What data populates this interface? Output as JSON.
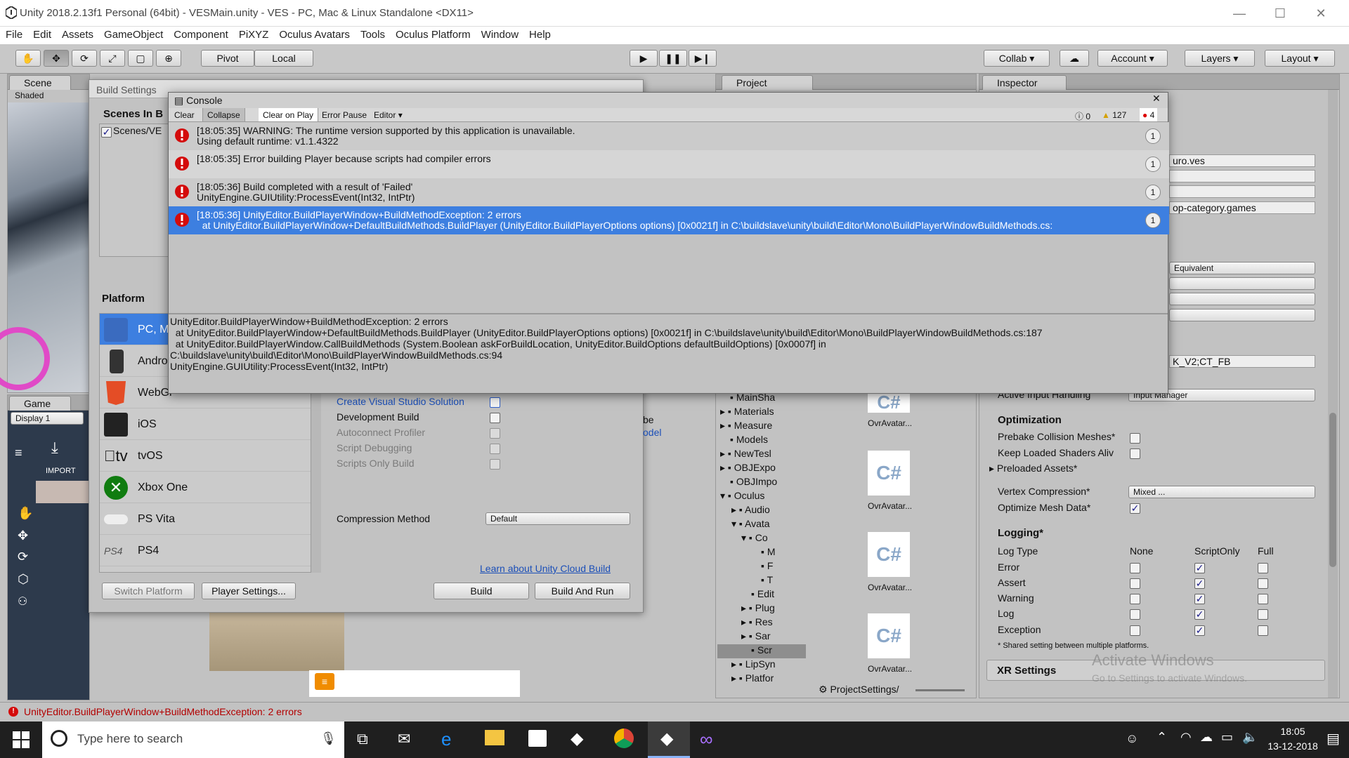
{
  "window": {
    "title": "Unity 2018.2.13f1 Personal (64bit) - VESMain.unity - VES - PC, Mac & Linux Standalone <DX11>"
  },
  "menu": [
    "File",
    "Edit",
    "Assets",
    "GameObject",
    "Component",
    "PiXYZ",
    "Oculus Avatars",
    "Tools",
    "Oculus Platform",
    "Window",
    "Help"
  ],
  "toolbar": {
    "pivot": "Pivot",
    "local": "Local",
    "collab": "Collab",
    "account": "Account",
    "layers": "Layers",
    "layout": "Layout"
  },
  "scene": {
    "tab": "Scene",
    "mode": "Shaded"
  },
  "game": {
    "tab": "Game",
    "display": "Display 1",
    "import": "IMPORT"
  },
  "project": {
    "tab": "Project",
    "tree": [
      "MainSha",
      "Materials",
      "Measure",
      "Models",
      "NewTesl",
      "OBJExpo",
      "OBJImpo",
      "Oculus",
      "Audio",
      "Avata",
      "Co",
      "M",
      "F",
      "T",
      "Edit",
      "Plug",
      "Res",
      "Sar",
      "Scr",
      "LipSyn",
      "Platfor"
    ],
    "files": [
      "OvrAvatar...",
      "OvrAvatar...",
      "OvrAvatar...",
      "OvrAvatar..."
    ],
    "file_glyph": "C#",
    "path": "ProjectSettings/"
  },
  "build": {
    "title": "Build Settings",
    "scenes_header": "Scenes In B",
    "scene_item": "Scenes/VE",
    "platform_header": "Platform",
    "platforms": [
      "PC, Ma",
      "Androi",
      "WebGl",
      "iOS",
      "tvOS",
      "Xbox One",
      "PS Vita",
      "PS4"
    ],
    "tvos_logo": "tv",
    "ps4_logo": "PS4",
    "options": [
      {
        "label": "Create Visual Studio Solution"
      },
      {
        "label": "Development Build"
      },
      {
        "label": "Autoconnect Profiler"
      },
      {
        "label": "Script Debugging"
      },
      {
        "label": "Scripts Only Build"
      }
    ],
    "compression_label": "Compression Method",
    "compression_value": "Default",
    "cloud_link": "Learn about Unity Cloud Build",
    "switch_platform": "Switch Platform",
    "player_settings": "Player Settings...",
    "build": "Build",
    "build_and_run": "Build And Run",
    "partial_be": "be",
    "partial_model": "odel"
  },
  "console": {
    "title": "Console",
    "buttons": [
      "Clear",
      "Collapse",
      "Clear on Play",
      "Error Pause",
      "Editor"
    ],
    "counts": {
      "info": "0",
      "warn": "127",
      "error": "4"
    },
    "rows": [
      {
        "text": "[18:05:35] WARNING: The runtime version supported by this application is unavailable.\nUsing default runtime: v1.1.4322",
        "count": "1"
      },
      {
        "text": "[18:05:35] Error building Player because scripts had compiler errors",
        "count": "1"
      },
      {
        "text": "[18:05:36] Build completed with a result of 'Failed'\nUnityEngine.GUIUtility:ProcessEvent(Int32, IntPtr)",
        "count": "1"
      },
      {
        "text": "[18:05:36] UnityEditor.BuildPlayerWindow+BuildMethodException: 2 errors\n  at UnityEditor.BuildPlayerWindow+DefaultBuildMethods.BuildPlayer (UnityEditor.BuildPlayerOptions options) [0x0021f] in C:\\buildslave\\unity\\build\\Editor\\Mono\\BuildPlayerWindowBuildMethods.cs:",
        "count": "1"
      }
    ],
    "detail": "UnityEditor.BuildPlayerWindow+BuildMethodException: 2 errors\n  at UnityEditor.BuildPlayerWindow+DefaultBuildMethods.BuildPlayer (UnityEditor.BuildPlayerOptions options) [0x0021f] in C:\\buildslave\\unity\\build\\Editor\\Mono\\BuildPlayerWindowBuildMethods.cs:187\n  at UnityEditor.BuildPlayerWindow.CallBuildMethods (System.Boolean askForBuildLocation, UnityEditor.BuildOptions defaultBuildOptions) [0x0007f] in\nC:\\buildslave\\unity\\build\\Editor\\Mono\\BuildPlayerWindowBuildMethods.cs:94\nUnityEngine.GUIUtility:ProcessEvent(Int32, IntPtr)"
  },
  "inspector": {
    "tab": "Inspector",
    "partial_values": [
      "uro.ves",
      "op-category.games",
      "Equivalent",
      "K_V2;CT_FB"
    ],
    "active_input_label": "Active Input Handling",
    "active_input_value": "Input Manager",
    "optimization": {
      "header": "Optimization",
      "prebake": "Prebake Collision Meshes*",
      "keep_shaders": "Keep Loaded Shaders Aliv",
      "preloaded": "Preloaded Assets*",
      "vertex": "Vertex Compression*",
      "vertex_value": "Mixed ...",
      "optimize": "Optimize Mesh Data*"
    },
    "logging": {
      "header": "Logging*",
      "col_type": "Log Type",
      "cols": [
        "None",
        "ScriptOnly",
        "Full"
      ],
      "rows": [
        "Error",
        "Assert",
        "Warning",
        "Log",
        "Exception"
      ],
      "note": "* Shared setting between multiple platforms."
    },
    "xr": "XR Settings",
    "watermark1": "Activate Windows",
    "watermark2": "Go to Settings to activate Windows."
  },
  "status": {
    "message": "UnityEditor.BuildPlayerWindow+BuildMethodException: 2 errors"
  },
  "taskbar": {
    "search": "Type here to search",
    "time": "18:05",
    "date": "13-12-2018"
  }
}
